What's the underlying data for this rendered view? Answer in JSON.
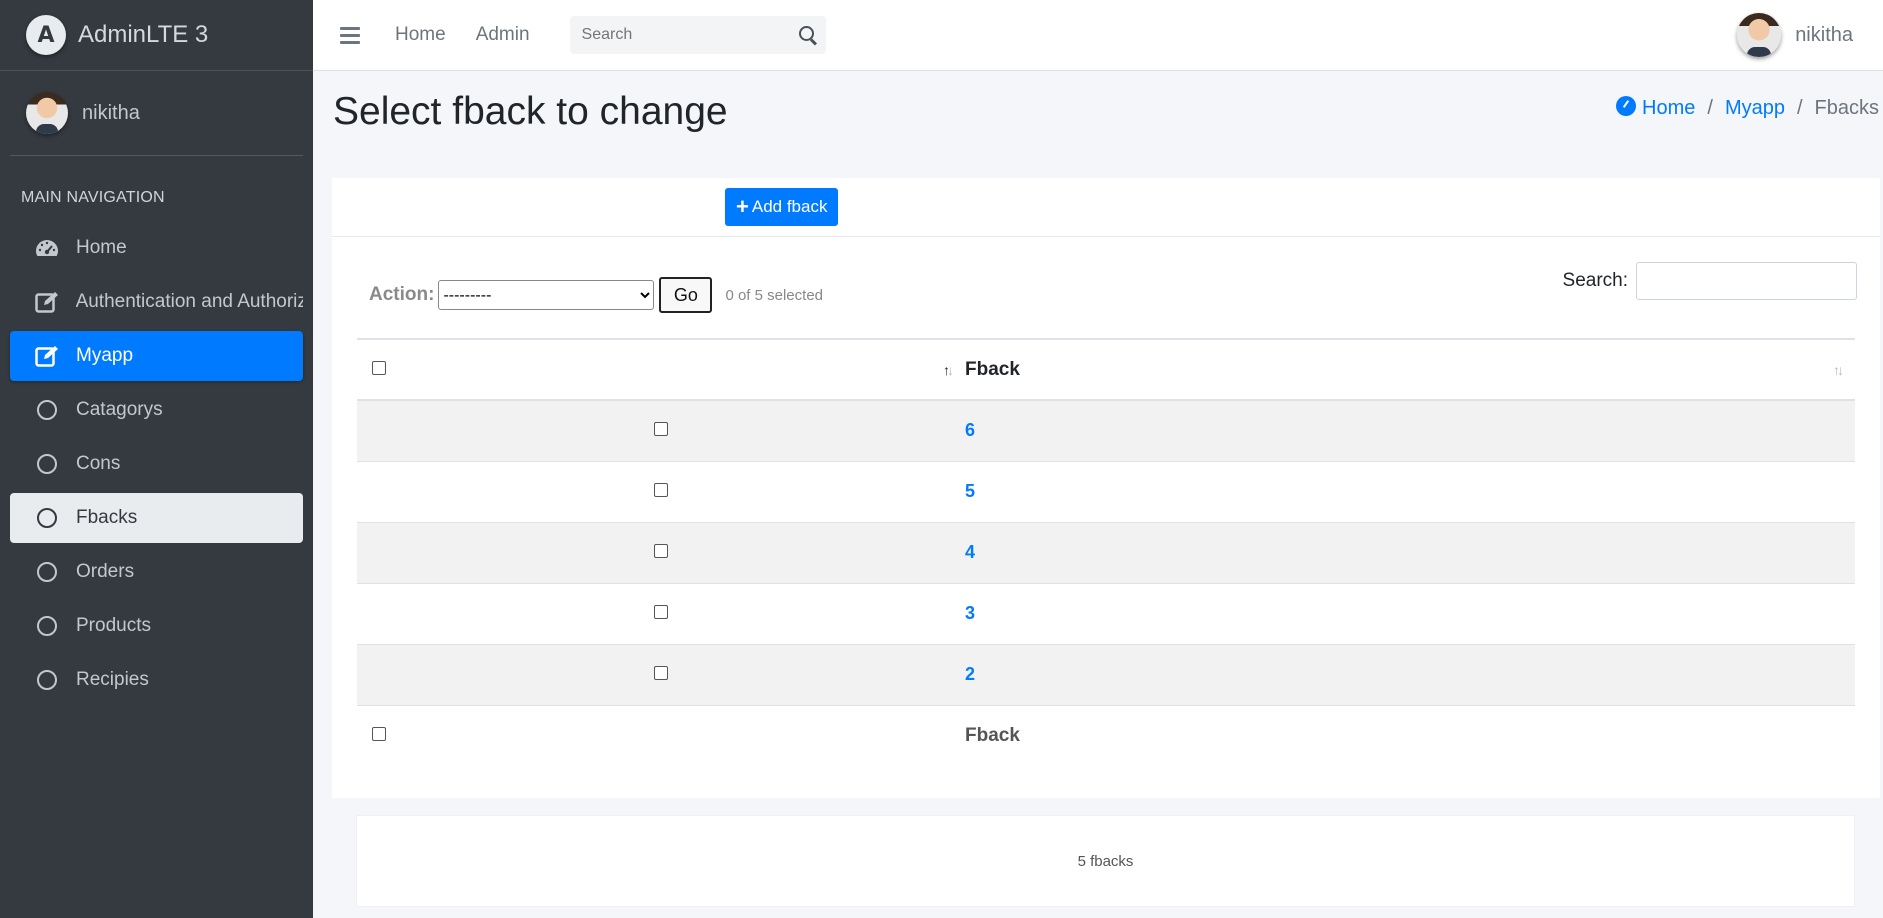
{
  "brand": {
    "name": "AdminLTE 3",
    "logo_letter": "A"
  },
  "user": {
    "name": "nikitha"
  },
  "sidebar": {
    "header": "MAIN NAVIGATION",
    "items": [
      {
        "label": "Home",
        "icon": "tachometer-icon"
      },
      {
        "label": "Authentication and Authoriz",
        "icon": "edit-icon"
      },
      {
        "label": "Myapp",
        "icon": "edit-icon",
        "state": "active"
      },
      {
        "label": "Catagorys",
        "icon": "circle-icon"
      },
      {
        "label": "Cons",
        "icon": "circle-icon"
      },
      {
        "label": "Fbacks",
        "icon": "circle-icon",
        "state": "selected"
      },
      {
        "label": "Orders",
        "icon": "circle-icon"
      },
      {
        "label": "Products",
        "icon": "circle-icon"
      },
      {
        "label": "Recipies",
        "icon": "circle-icon"
      }
    ]
  },
  "topbar": {
    "links": [
      "Home",
      "Admin"
    ],
    "search_placeholder": "Search"
  },
  "page": {
    "title": "Select fback to change",
    "breadcrumb": [
      "Home",
      "Myapp",
      "Fbacks"
    ]
  },
  "toolbar": {
    "add_label": "Add fback",
    "action_label": "Action:",
    "action_value": "---------",
    "go_label": "Go",
    "selected_text": "0 of 5 selected",
    "search_label": "Search:"
  },
  "table": {
    "column": "Fback",
    "rows": [
      "6",
      "5",
      "4",
      "3",
      "2"
    ],
    "footer_column": "Fback"
  },
  "summary": "5 fbacks",
  "colors": {
    "sidebar": "#343a40",
    "accent": "#007bff",
    "content_bg": "#f4f6f9"
  }
}
